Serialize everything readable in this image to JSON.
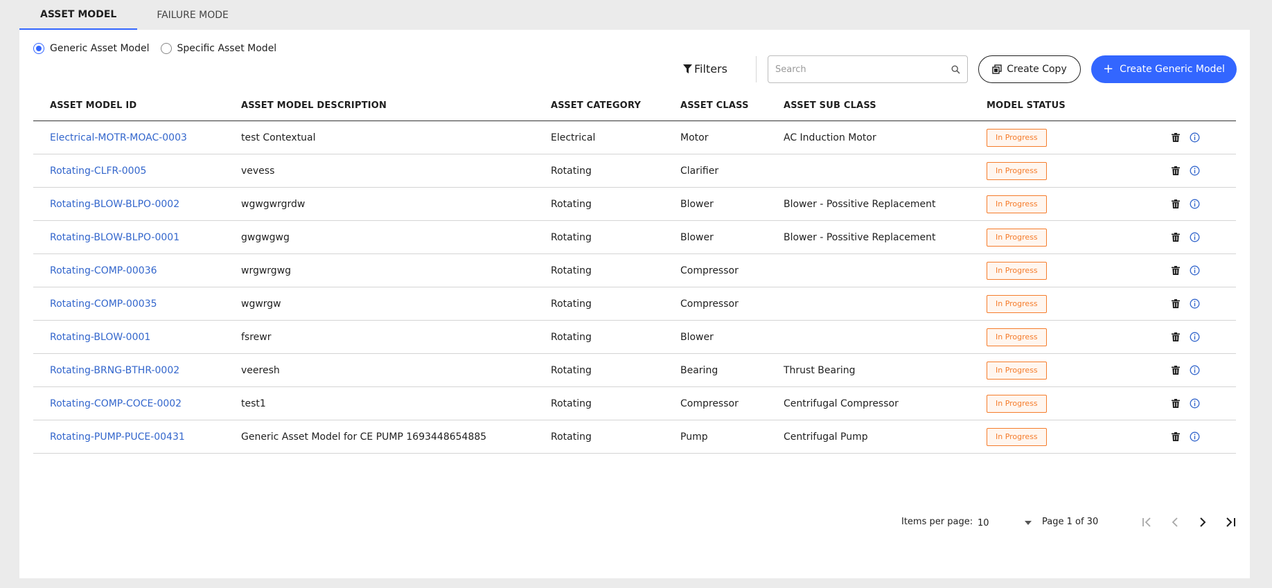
{
  "tabs": [
    {
      "label": "ASSET MODEL",
      "active": true
    },
    {
      "label": "FAILURE MODE",
      "active": false
    }
  ],
  "model_type": {
    "options": [
      "Generic Asset Model",
      "Specific Asset Model"
    ],
    "selected": "Generic Asset Model"
  },
  "toolbar": {
    "filters_label": "Filters",
    "search_placeholder": "Search",
    "create_copy_label": "Create Copy",
    "create_generic_label": "Create Generic Model"
  },
  "table": {
    "columns": [
      "ASSET MODEL ID",
      "ASSET MODEL DESCRIPTION",
      "ASSET CATEGORY",
      "ASSET CLASS",
      "ASSET SUB CLASS",
      "MODEL STATUS"
    ],
    "rows": [
      {
        "id": "Electrical-MOTR-MOAC-0003",
        "description": "test Contextual",
        "category": "Electrical",
        "class": "Motor",
        "sub_class": "AC Induction Motor",
        "status": "In Progress"
      },
      {
        "id": "Rotating-CLFR-0005",
        "description": "vevess",
        "category": "Rotating",
        "class": "Clarifier",
        "sub_class": "",
        "status": "In Progress"
      },
      {
        "id": "Rotating-BLOW-BLPO-0002",
        "description": "wgwgwrgrdw",
        "category": "Rotating",
        "class": "Blower",
        "sub_class": "Blower - Possitive Replacement",
        "status": "In Progress"
      },
      {
        "id": "Rotating-BLOW-BLPO-0001",
        "description": "gwgwgwg",
        "category": "Rotating",
        "class": "Blower",
        "sub_class": "Blower - Possitive Replacement",
        "status": "In Progress"
      },
      {
        "id": "Rotating-COMP-00036",
        "description": "wrgwrgwg",
        "category": "Rotating",
        "class": "Compressor",
        "sub_class": "",
        "status": "In Progress"
      },
      {
        "id": "Rotating-COMP-00035",
        "description": "wgwrgw",
        "category": "Rotating",
        "class": "Compressor",
        "sub_class": "",
        "status": "In Progress"
      },
      {
        "id": "Rotating-BLOW-0001",
        "description": "fsrewr",
        "category": "Rotating",
        "class": "Blower",
        "sub_class": "",
        "status": "In Progress"
      },
      {
        "id": "Rotating-BRNG-BTHR-0002",
        "description": "veeresh",
        "category": "Rotating",
        "class": "Bearing",
        "sub_class": "Thrust Bearing",
        "status": "In Progress"
      },
      {
        "id": "Rotating-COMP-COCE-0002",
        "description": "test1",
        "category": "Rotating",
        "class": "Compressor",
        "sub_class": "Centrifugal Compressor",
        "status": "In Progress"
      },
      {
        "id": "Rotating-PUMP-PUCE-00431",
        "description": "Generic Asset Model for CE PUMP 1693448654885",
        "category": "Rotating",
        "class": "Pump",
        "sub_class": "Centrifugal Pump",
        "status": "In Progress"
      }
    ]
  },
  "pagination": {
    "items_per_page_label": "Items per page:",
    "items_per_page": "10",
    "page_label": "Page 1 of 30"
  },
  "colors": {
    "accent": "#3366ff",
    "link": "#3366cc",
    "status_in_progress": "#f57c2b"
  }
}
